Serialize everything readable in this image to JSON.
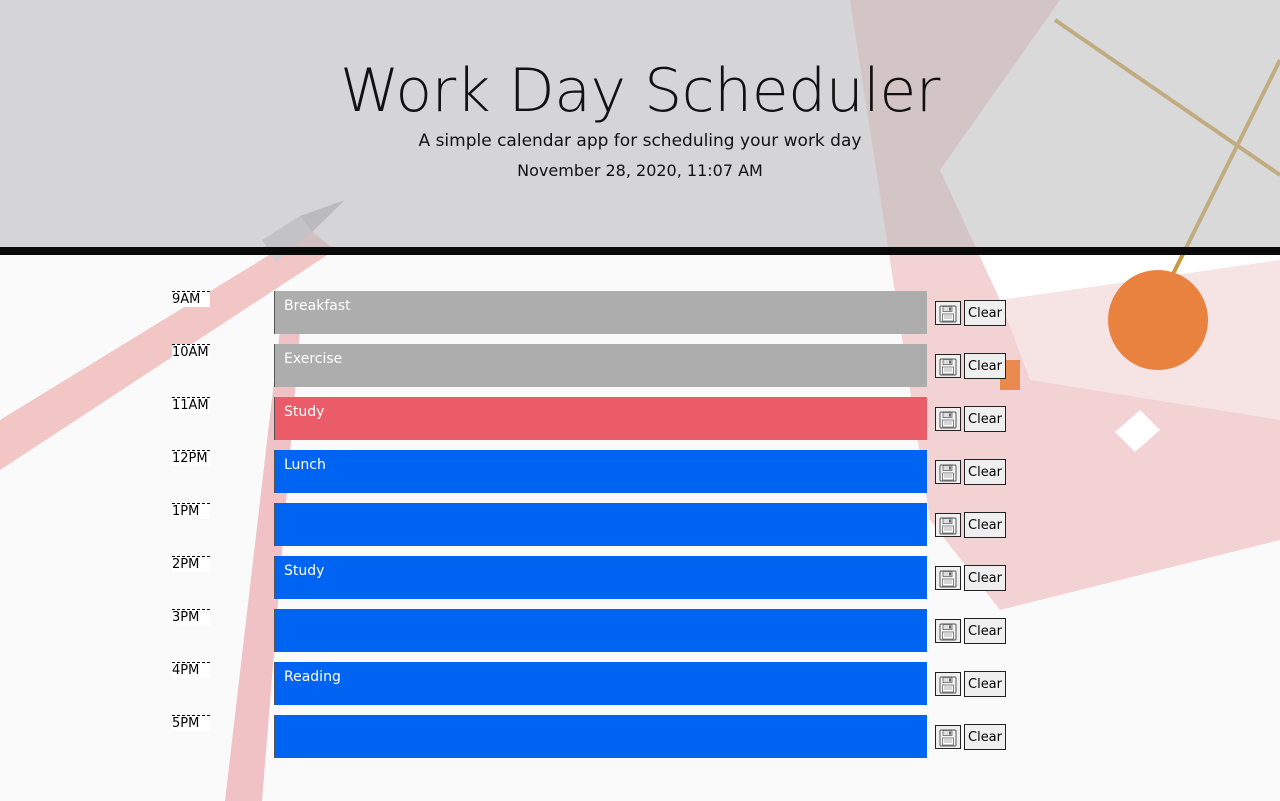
{
  "header": {
    "title": "Work Day Scheduler",
    "subtitle": "A simple calendar app for scheduling your work day",
    "current_datetime": "November 28, 2020, 11:07 AM"
  },
  "colors": {
    "past": "#adadad",
    "present": "#e95c68",
    "future": "#0064f2"
  },
  "schedule": [
    {
      "hour": "9AM",
      "text": "Breakfast",
      "status": "past",
      "save_icon": "floppy-disk-icon",
      "clear_label": "Clear"
    },
    {
      "hour": "10AM",
      "text": "Exercise",
      "status": "past",
      "save_icon": "floppy-disk-icon",
      "clear_label": "Clear"
    },
    {
      "hour": "11AM",
      "text": "Study",
      "status": "present",
      "save_icon": "floppy-disk-icon",
      "clear_label": "Clear"
    },
    {
      "hour": "12PM",
      "text": "Lunch",
      "status": "future",
      "save_icon": "floppy-disk-icon",
      "clear_label": "Clear"
    },
    {
      "hour": "1PM",
      "text": "",
      "status": "future",
      "save_icon": "floppy-disk-icon",
      "clear_label": "Clear"
    },
    {
      "hour": "2PM",
      "text": "Study",
      "status": "future",
      "save_icon": "floppy-disk-icon",
      "clear_label": "Clear"
    },
    {
      "hour": "3PM",
      "text": "",
      "status": "future",
      "save_icon": "floppy-disk-icon",
      "clear_label": "Clear"
    },
    {
      "hour": "4PM",
      "text": "Reading",
      "status": "future",
      "save_icon": "floppy-disk-icon",
      "clear_label": "Clear"
    },
    {
      "hour": "5PM",
      "text": "",
      "status": "future",
      "save_icon": "floppy-disk-icon",
      "clear_label": "Clear"
    }
  ]
}
